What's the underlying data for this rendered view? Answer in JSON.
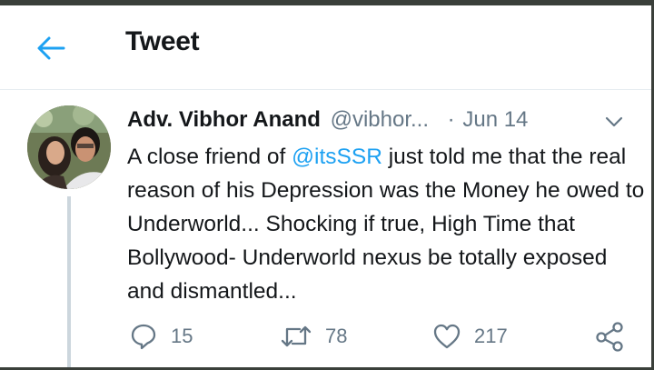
{
  "header": {
    "title": "Tweet",
    "back_icon": "arrow-left-icon"
  },
  "tweet": {
    "author_name": "Adv. Vibhor Anand",
    "author_handle": "@vibhor...",
    "dot": "·",
    "date": "Jun 14",
    "text_before": "A close friend of ",
    "mention": "@itsSSR",
    "text_after": " just told me that the real reason of his Depression was the Money he owed to Underworld... Shocking if true,  High Time that Bollywood- Underworld nexus be totally exposed and dismantled..."
  },
  "actions": {
    "reply_count": "15",
    "retweet_count": "78",
    "like_count": "217"
  },
  "colors": {
    "accent": "#1da1f2",
    "muted": "#657786",
    "text": "#14171a"
  }
}
